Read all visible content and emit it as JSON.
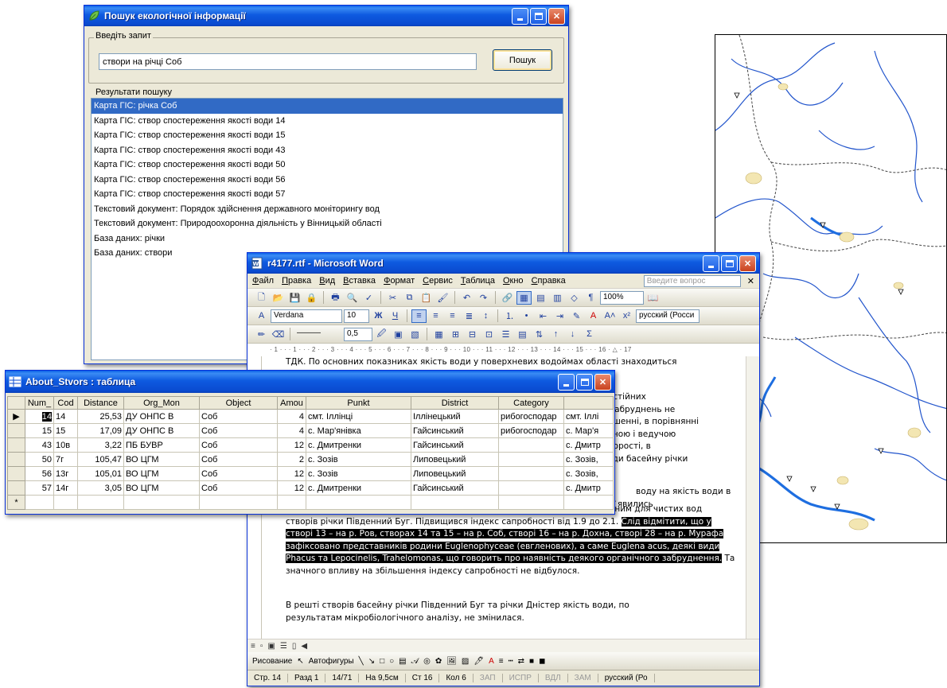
{
  "search_window": {
    "title": "Пошук екологічної інформації",
    "query_group_label": "Введіть запит",
    "query_value": "створи на річці Соб",
    "search_button": "Пошук",
    "results_group_label": "Результати пошуку",
    "results": [
      "Карта ГІС: річка Соб",
      "Карта ГІС: створ спостереження якості води 14",
      "Карта ГІС: створ спостереження якості води 15",
      "Карта ГІС: створ спостереження якості води 43",
      "Карта ГІС: створ спостереження якості води 50",
      "Карта ГІС: створ спостереження якості води 56",
      "Карта ГІС: створ спостереження якості води 57",
      "Текстовий документ: Порядок здійснення державного моніторингу вод",
      "Текстовий документ: Природоохоронна діяльність у Вінницькій області",
      "База даних: річки",
      "База даних: створи"
    ]
  },
  "word_window": {
    "title": "r4177.rtf - Microsoft Word",
    "menu": [
      "Файл",
      "Правка",
      "Вид",
      "Вставка",
      "Формат",
      "Сервис",
      "Таблица",
      "Окно",
      "Справка"
    ],
    "ask_placeholder": "Введите вопрос",
    "zoom": "100%",
    "style": "Verdana",
    "font_size": "10",
    "language": "русский (Росси",
    "line_width": "0,5",
    "ruler_text": "· 1 · · · 1 · · · 2 · · · 3 · · · 4 · · · 5 · · · 6 · · · 7 · · · 8 · · · 9 · · · 10 · · · 11 · · · 12 · · · 13 · · · 14 · · · 15 · · · 16 · △ · 17",
    "doc_line_top": "ТДК. По основних показниках якість води у поверхневих водоймах області знаходиться",
    "doc_fragments": [
      "постійних",
      "х забруднень не",
      "ношенні, в порівнянні",
      "льною і ведучою",
      "одорості, в",
      " води басейну річки"
    ],
    "doc_frag2": "воду на якість води в",
    "doc_frag3": "з`явились",
    "doc_para_main": "представники родини Flagellata (безхлорні джгутикові), що не є характерним для чистих вод створів річки Південний Буг. Підвищився індекс сапробності від 1.9 до 2.1.",
    "doc_highlight": "Слід відмітити, що у створі 13 – на р. Ров, створах 14 та 15 – на р. Соб, створі 16 – на р. Дохна, створі 28 – на р. Мурафа зафіксовано представників родини Euglenophyceae (евгленових), а саме Euglena acus, деякі види Phacus та Lepocinelis, Trahelomonas, що говорить про наявність деякого органічного забруднення.",
    "doc_para_tail": " Та значного впливу на збільшення індексу сапробності не відбулося.",
    "doc_para_last": "В решті створів басейну річки Південний Буг та річки Дністер якість води, по результатам мікробіологічного аналізу, не змінилася.",
    "draw_label": "Рисование",
    "autoshapes_label": "Автофигуры",
    "status": {
      "page": "Стр. 14",
      "section": "Разд 1",
      "pages": "14/71",
      "at": "На 9,5см",
      "line": "Ст 16",
      "col": "Кол 6",
      "rec": "ЗАП",
      "trk": "ИСПР",
      "ext": "ВДЛ",
      "ovr": "ЗАМ",
      "lang": "русский (Ро"
    }
  },
  "table_window": {
    "title": "About_Stvors : таблица",
    "columns": [
      "Num_",
      "Cod",
      "Distance",
      "Org_Mon",
      "Object",
      "Amou",
      "Punkt",
      "District",
      "Category",
      ""
    ],
    "rows": [
      [
        "14",
        "14",
        "25,53",
        "ДУ ОНПС В",
        "Соб",
        "4",
        "смт. Іллінці",
        "Іллінецький",
        "рибогосподар",
        "смт. Іллі"
      ],
      [
        "15",
        "15",
        "17,09",
        "ДУ ОНПС В",
        "Соб",
        "4",
        "с. Мар'янівка",
        "Гайсинський",
        "рибогосподар",
        "с. Мар'я"
      ],
      [
        "43",
        "10в",
        "3,22",
        "ПБ БУВР",
        "Соб",
        "12",
        "с. Дмитренки",
        "Гайсинський",
        "",
        "с. Дмитр"
      ],
      [
        "50",
        "7г",
        "105,47",
        "ВО ЦГМ",
        "Соб",
        "2",
        "с. Зозів",
        "Липовецький",
        "",
        "с. Зозів,"
      ],
      [
        "56",
        "13г",
        "105,01",
        "ВО ЦГМ",
        "Соб",
        "12",
        "с. Зозів",
        "Липовецький",
        "",
        "с. Зозів,"
      ],
      [
        "57",
        "14г",
        "3,05",
        "ВО ЦГМ",
        "Соб",
        "12",
        "с. Дмитренки",
        "Гайсинський",
        "",
        "с. Дмитр"
      ]
    ],
    "new_row_marker": "*"
  }
}
